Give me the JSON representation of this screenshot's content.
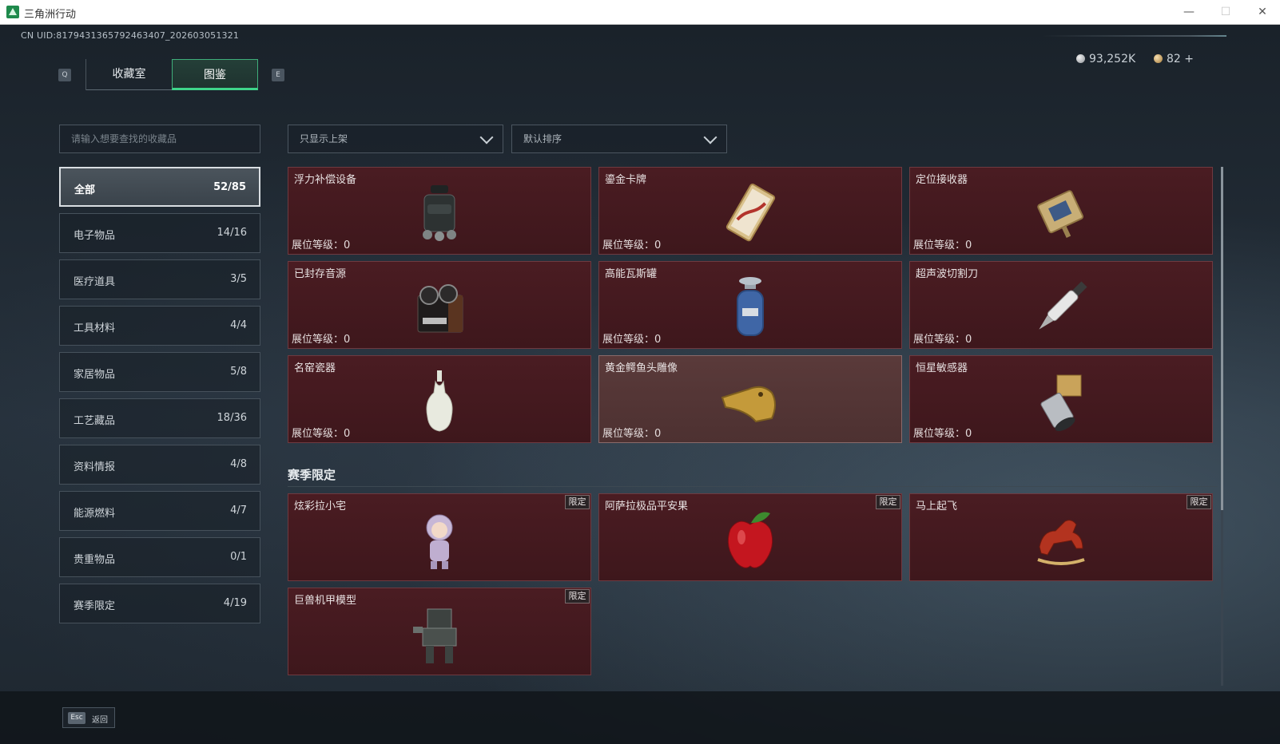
{
  "window": {
    "title": "三角洲行动",
    "min": "—",
    "max": "☐",
    "close": "✕"
  },
  "uid": "CN UID:8179431365792463407_202603051321",
  "keys": {
    "prev": "Q",
    "next": "E"
  },
  "tabs": [
    {
      "label": "收藏室"
    },
    {
      "label": "图鉴"
    }
  ],
  "currency": {
    "silver": "93,252K",
    "gold": "82 +"
  },
  "search": {
    "placeholder": "请输入想要查找的收藏品"
  },
  "filters": {
    "shelf": "只显示上架",
    "sort": "默认排序"
  },
  "categories": [
    {
      "name": "全部",
      "count": "52/85"
    },
    {
      "name": "电子物品",
      "count": "14/16"
    },
    {
      "name": "医疗道具",
      "count": "3/5"
    },
    {
      "name": "工具材料",
      "count": "4/4"
    },
    {
      "name": "家居物品",
      "count": "5/8"
    },
    {
      "name": "工艺藏品",
      "count": "18/36"
    },
    {
      "name": "资料情报",
      "count": "4/8"
    },
    {
      "name": "能源燃料",
      "count": "4/7"
    },
    {
      "name": "贵重物品",
      "count": "0/1"
    },
    {
      "name": "赛季限定",
      "count": "4/19"
    }
  ],
  "items": [
    {
      "name": "浮力补偿设备",
      "level": "展位等级：0",
      "icon": "bcd-backpack-icon"
    },
    {
      "name": "鎏金卡牌",
      "level": "展位等级：0",
      "icon": "gilded-card-icon"
    },
    {
      "name": "定位接收器",
      "level": "展位等级：0",
      "icon": "gps-receiver-icon"
    },
    {
      "name": "已封存音源",
      "level": "展位等级：0",
      "icon": "reel-recorder-icon"
    },
    {
      "name": "高能瓦斯罐",
      "level": "展位等级：0",
      "icon": "gas-canister-icon"
    },
    {
      "name": "超声波切割刀",
      "level": "展位等级：0",
      "icon": "ultrasonic-cutter-icon"
    },
    {
      "name": "名窑瓷器",
      "level": "展位等级：0",
      "icon": "porcelain-vase-icon"
    },
    {
      "name": "黄金鳄鱼头雕像",
      "level": "展位等级：0",
      "icon": "gold-crocodile-head-icon"
    },
    {
      "name": "恒星敏感器",
      "level": "展位等级：0",
      "icon": "star-sensor-icon"
    }
  ],
  "season": {
    "title": "赛季限定",
    "badge": "限定",
    "items": [
      {
        "name": "炫彩拉小宅",
        "icon": "figurine-icon"
      },
      {
        "name": "阿萨拉极品平安果",
        "icon": "red-apple-icon"
      },
      {
        "name": "马上起飞",
        "icon": "red-horse-icon"
      },
      {
        "name": "巨兽机甲模型",
        "icon": "mech-model-icon"
      }
    ]
  },
  "footer": {
    "key": "Esc",
    "label": "返回"
  }
}
